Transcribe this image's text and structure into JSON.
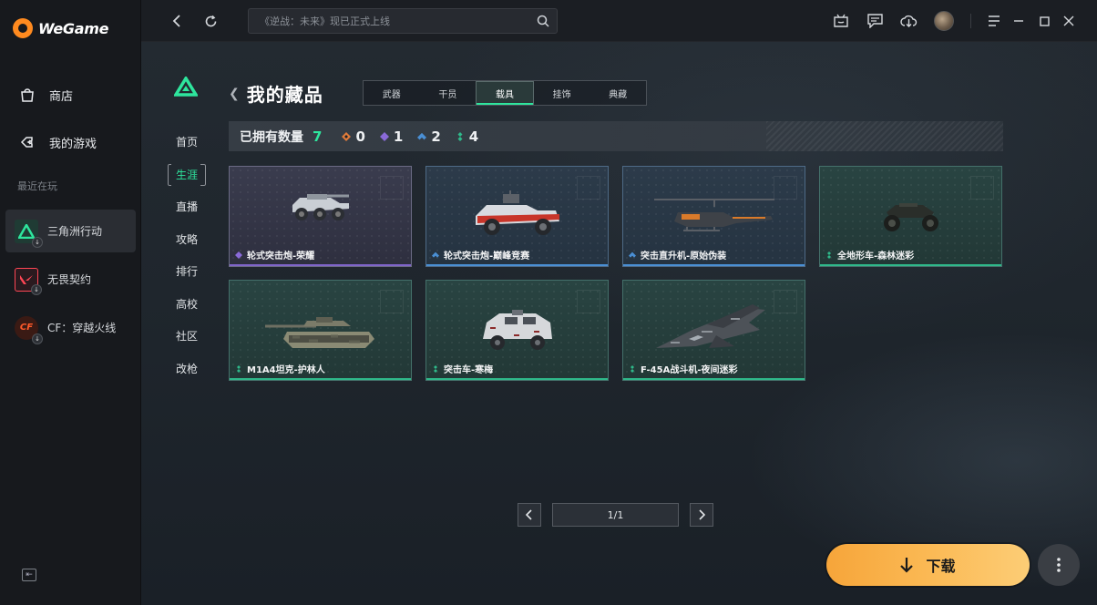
{
  "app": {
    "logo_text": "WeGame"
  },
  "sidebar": {
    "nav": [
      {
        "label": "商店",
        "icon": "bag-icon"
      },
      {
        "label": "我的游戏",
        "icon": "gamepad-icon"
      }
    ],
    "recent_label": "最近在玩",
    "recent": [
      {
        "label": "三角洲行动",
        "active": true
      },
      {
        "label": "无畏契约",
        "active": false
      },
      {
        "label": "CF：穿越火线",
        "active": false
      }
    ]
  },
  "topbar": {
    "search_placeholder": "《逆战：未来》现已正式上线"
  },
  "subnav": {
    "items": [
      "首页",
      "生涯",
      "直播",
      "攻略",
      "排行",
      "高校",
      "社区",
      "改枪"
    ],
    "active_index": 1
  },
  "page": {
    "title": "我的藏品",
    "tabs": [
      "武器",
      "干员",
      "载具",
      "挂饰",
      "典藏"
    ],
    "active_tab": 2,
    "count_label": "已拥有数量",
    "count_total": "7",
    "rarity_counts": [
      {
        "icon": "gold-diamond-icon",
        "color": "#e07b3a",
        "value": "0"
      },
      {
        "icon": "purple-diamond-icon",
        "color": "#8a6ad8",
        "value": "1"
      },
      {
        "icon": "blue-double-diamond-icon",
        "color": "#4a8fd4",
        "value": "2"
      },
      {
        "icon": "green-dots-icon",
        "color": "#2fb98a",
        "value": "4"
      }
    ],
    "items": [
      {
        "name": "轮式突击炮-荣耀",
        "rarity": "epic",
        "vehicle": "wheeled-assault-gun"
      },
      {
        "name": "轮式突击炮-巅峰竞赛",
        "rarity": "rare",
        "vehicle": "assault-truck-red"
      },
      {
        "name": "突击直升机-原始伪装",
        "rarity": "rare",
        "vehicle": "helicopter"
      },
      {
        "name": "全地形车-森林迷彩",
        "rarity": "uncommon",
        "vehicle": "atv"
      },
      {
        "name": "M1A4坦克-护林人",
        "rarity": "uncommon",
        "vehicle": "tank"
      },
      {
        "name": "突击车-寒梅",
        "rarity": "uncommon",
        "vehicle": "armored-car"
      },
      {
        "name": "F-45A战斗机-夜间迷彩",
        "rarity": "uncommon",
        "vehicle": "fighter-jet"
      }
    ]
  },
  "pager": {
    "text": "1/1"
  },
  "download": {
    "label": "下载"
  },
  "colors": {
    "accent": "#2ee59d",
    "download": "#fbb954"
  }
}
